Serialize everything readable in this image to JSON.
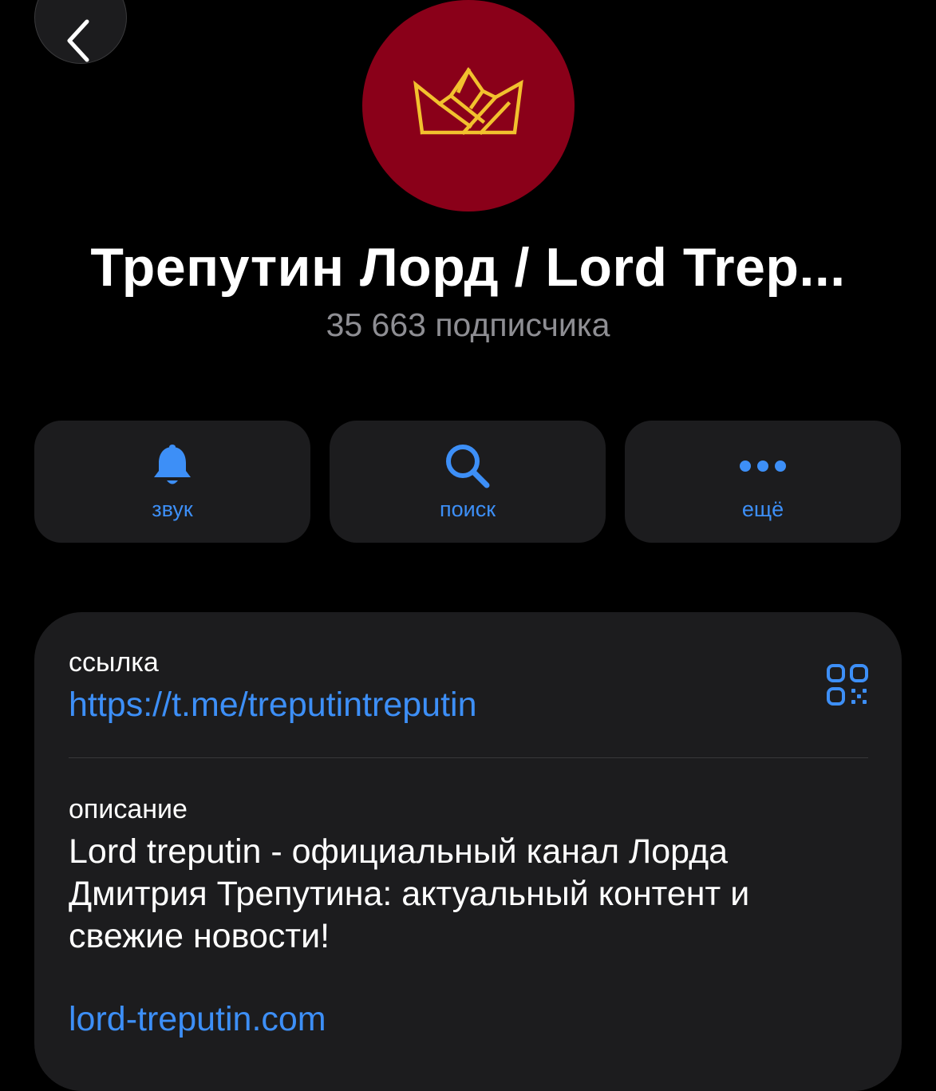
{
  "header": {
    "back_icon": "chevron-left-icon"
  },
  "channel": {
    "avatar_icon": "crown-icon",
    "avatar_color": "#8a0019",
    "crown_color": "#f2c12e",
    "title": "Трепутин Лорд / Lord Trep...",
    "subscribers": "35 663 подписчика"
  },
  "actions": [
    {
      "label": "звук",
      "icon": "bell-icon"
    },
    {
      "label": "поиск",
      "icon": "search-icon"
    },
    {
      "label": "ещё",
      "icon": "more-dots-icon"
    }
  ],
  "info": {
    "link_label": "ссылка",
    "link_value": "https://t.me/treputintreputin",
    "qr_icon": "qr-code-icon",
    "description_label": "описание",
    "description_text": "Lord treputin - официальный канал Лорда Дмитрия Трепутина: актуальный контент и свежие новости!",
    "website": "lord-treputin.com"
  },
  "colors": {
    "accent": "#3d8ff7",
    "background": "#000000",
    "card": "#1c1c1e",
    "secondary_text": "#8e8e93"
  }
}
